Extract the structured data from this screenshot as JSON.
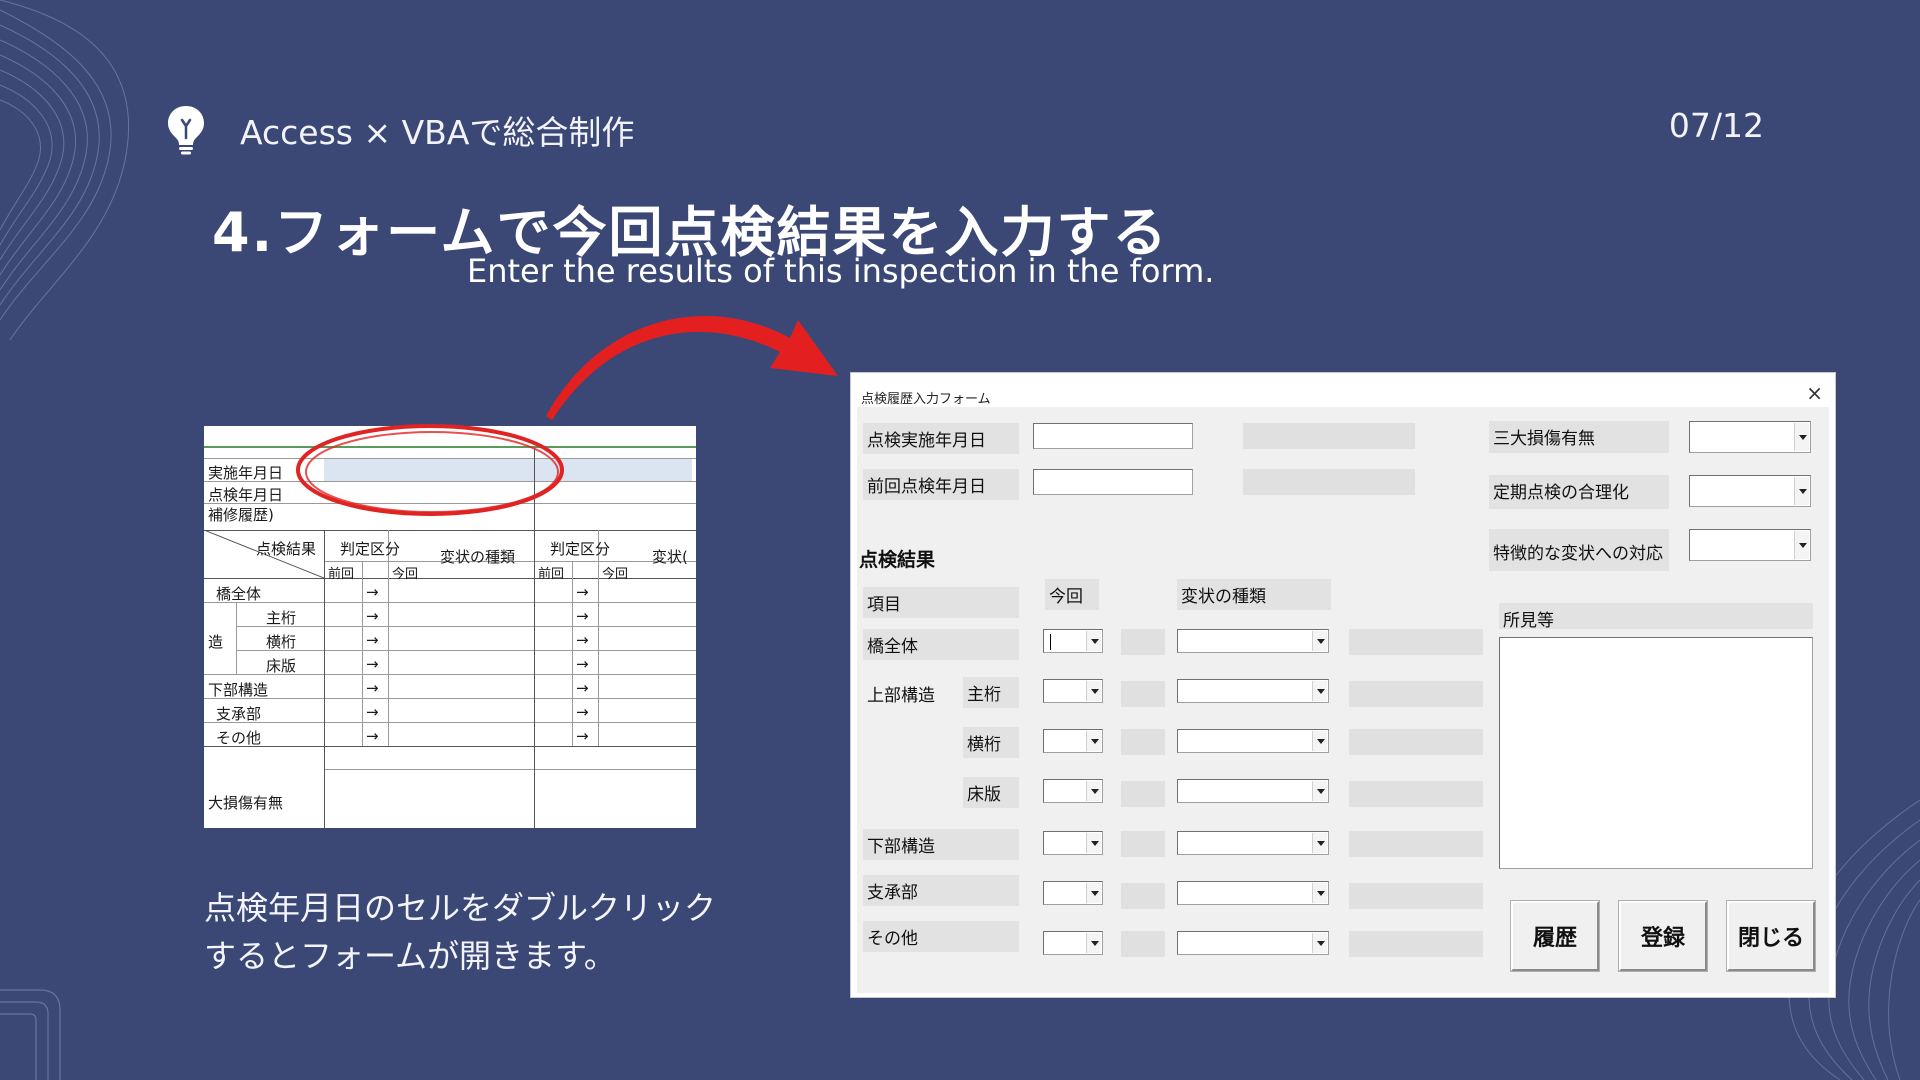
{
  "header": {
    "title": "Access × VBAで総合制作",
    "page_number": "07/12"
  },
  "heading": {
    "main": "4.フォームで今回点検結果を入力する",
    "sub": "Enter the results of this inspection in the form."
  },
  "description": "点検年月日のセルをダブルクリックするとフォームが開きます。",
  "sheet": {
    "row_labels": [
      "実施年月日",
      "点検年月日",
      "補修履歴)"
    ],
    "header_result": "点検結果",
    "header_judgement": "判定区分",
    "header_prev": "前回",
    "header_curr": "今回",
    "header_type": "変状の種類",
    "header_type_cut": "変状(",
    "items": [
      "橋全体",
      "主桁",
      "横桁",
      "床版",
      "下部構造",
      "支承部",
      "その他"
    ],
    "structure_label": "造",
    "arrow": "→",
    "damage_label": "大損傷有無"
  },
  "form": {
    "title": "点検履歴入力フォーム",
    "close_symbol": "×",
    "date_current_label": "点検実施年月日",
    "date_previous_label": "前回点検年月日",
    "section_result": "点検結果",
    "col_item": "項目",
    "col_current": "今回",
    "col_type": "変状の種類",
    "rows": [
      {
        "label": "橋全体"
      },
      {
        "group": "上部構造",
        "label": "主桁"
      },
      {
        "label": "横桁"
      },
      {
        "label": "床版"
      },
      {
        "label": "下部構造"
      },
      {
        "label": "支承部"
      },
      {
        "label": "その他"
      }
    ],
    "right": {
      "major_damage_label": "三大損傷有無",
      "periodic_rationalization_label": "定期点検の合理化",
      "characteristic_response_label": "特徴的な変状への対応",
      "findings_label": "所見等"
    },
    "buttons": {
      "history": "履歴",
      "register": "登録",
      "close": "閉じる"
    }
  }
}
